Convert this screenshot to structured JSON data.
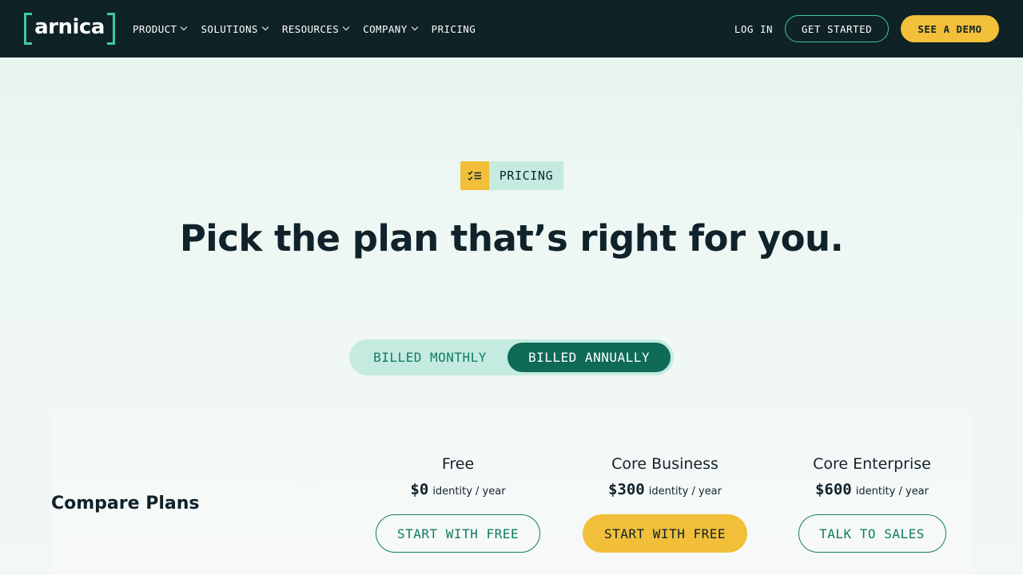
{
  "nav": {
    "logo_text": "arnica",
    "items": [
      {
        "label": "PRODUCT",
        "dropdown": true
      },
      {
        "label": "SOLUTIONS",
        "dropdown": true
      },
      {
        "label": "RESOURCES",
        "dropdown": true
      },
      {
        "label": "COMPANY",
        "dropdown": true
      },
      {
        "label": "PRICING",
        "dropdown": false
      }
    ],
    "login_label": "LOG IN",
    "get_started_label": "GET STARTED",
    "demo_label": "SEE A DEMO"
  },
  "hero": {
    "badge_icon": "checklist-icon",
    "badge_label": "PRICING",
    "headline": "Pick the plan that’s right for you."
  },
  "billing": {
    "monthly_label": "BILLED MONTHLY",
    "annually_label": "BILLED ANNUALLY",
    "selected": "annually"
  },
  "plans": {
    "section_title": "Compare Plans",
    "items": [
      {
        "name": "Free",
        "price": "$0",
        "unit": "identity / year",
        "cta": "START WITH FREE"
      },
      {
        "name": "Core Business",
        "price": "$300",
        "unit": "identity / year",
        "cta": "START WITH FREE"
      },
      {
        "name": "Core Enterprise",
        "price": "$600",
        "unit": "identity / year",
        "cta": "TALK TO SALES"
      }
    ]
  },
  "colors": {
    "nav_bg": "#0f2226",
    "accent_green": "#3fc9a6",
    "dark_green": "#0f6a57",
    "yellow": "#f1bf3a",
    "mint": "#c5ebe0"
  }
}
